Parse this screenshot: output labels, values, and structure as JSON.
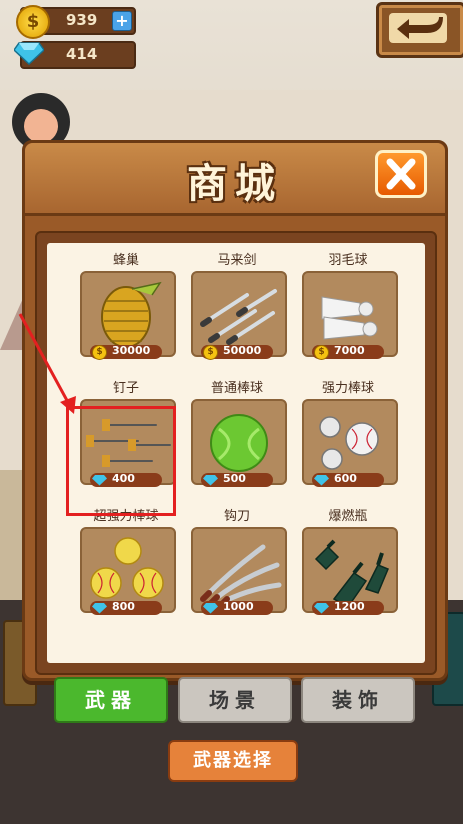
{
  "currency": {
    "coins": "939",
    "gems": "414",
    "plus_label": "+"
  },
  "shop": {
    "title": "商城",
    "items": [
      {
        "name": "蜂巢",
        "price": "30000",
        "currency": "coin"
      },
      {
        "name": "马来剑",
        "price": "50000",
        "currency": "coin"
      },
      {
        "name": "羽毛球",
        "price": "7000",
        "currency": "coin"
      },
      {
        "name": "钉子",
        "price": "400",
        "currency": "gem"
      },
      {
        "name": "普通棒球",
        "price": "500",
        "currency": "gem"
      },
      {
        "name": "强力棒球",
        "price": "600",
        "currency": "gem"
      },
      {
        "name": "超强力棒球",
        "price": "800",
        "currency": "gem"
      },
      {
        "name": "钩刀",
        "price": "1000",
        "currency": "gem"
      },
      {
        "name": "爆燃瓶",
        "price": "1200",
        "currency": "gem"
      }
    ]
  },
  "tabs": {
    "weapon": "武器",
    "scene": "场景",
    "decoration": "装饰"
  },
  "weapon_select": "武器选择",
  "colors": {
    "coin": "#f5c211",
    "gem": "#3fc3e8",
    "active_tab": "#4bb82d",
    "highlight": "#e32020"
  }
}
